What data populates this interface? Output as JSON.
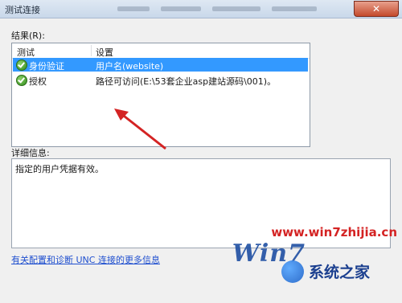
{
  "window": {
    "title": "测试连接",
    "close_symbol": "✕"
  },
  "results": {
    "label": "结果(R):",
    "columns": [
      "测试",
      "设置"
    ],
    "rows": [
      {
        "test": "身份验证",
        "setting": "用户名(website)",
        "icon": "check-circle-icon",
        "selected": true
      },
      {
        "test": "授权",
        "setting": "路径可访问(E:\\53套企业asp建站源码\\001)。",
        "icon": "check-circle-icon",
        "selected": false
      }
    ]
  },
  "details": {
    "label": "详细信息:",
    "text": "指定的用户凭据有效。"
  },
  "help_link": "有关配置和诊断 UNC 连接的更多信息",
  "watermark": {
    "url": "www.win7zhijia.cn",
    "win_text": "Win7",
    "brand": "系统之家"
  },
  "colors": {
    "selection": "#3399ff",
    "link": "#1f4fcf",
    "arrow": "#d42323"
  }
}
